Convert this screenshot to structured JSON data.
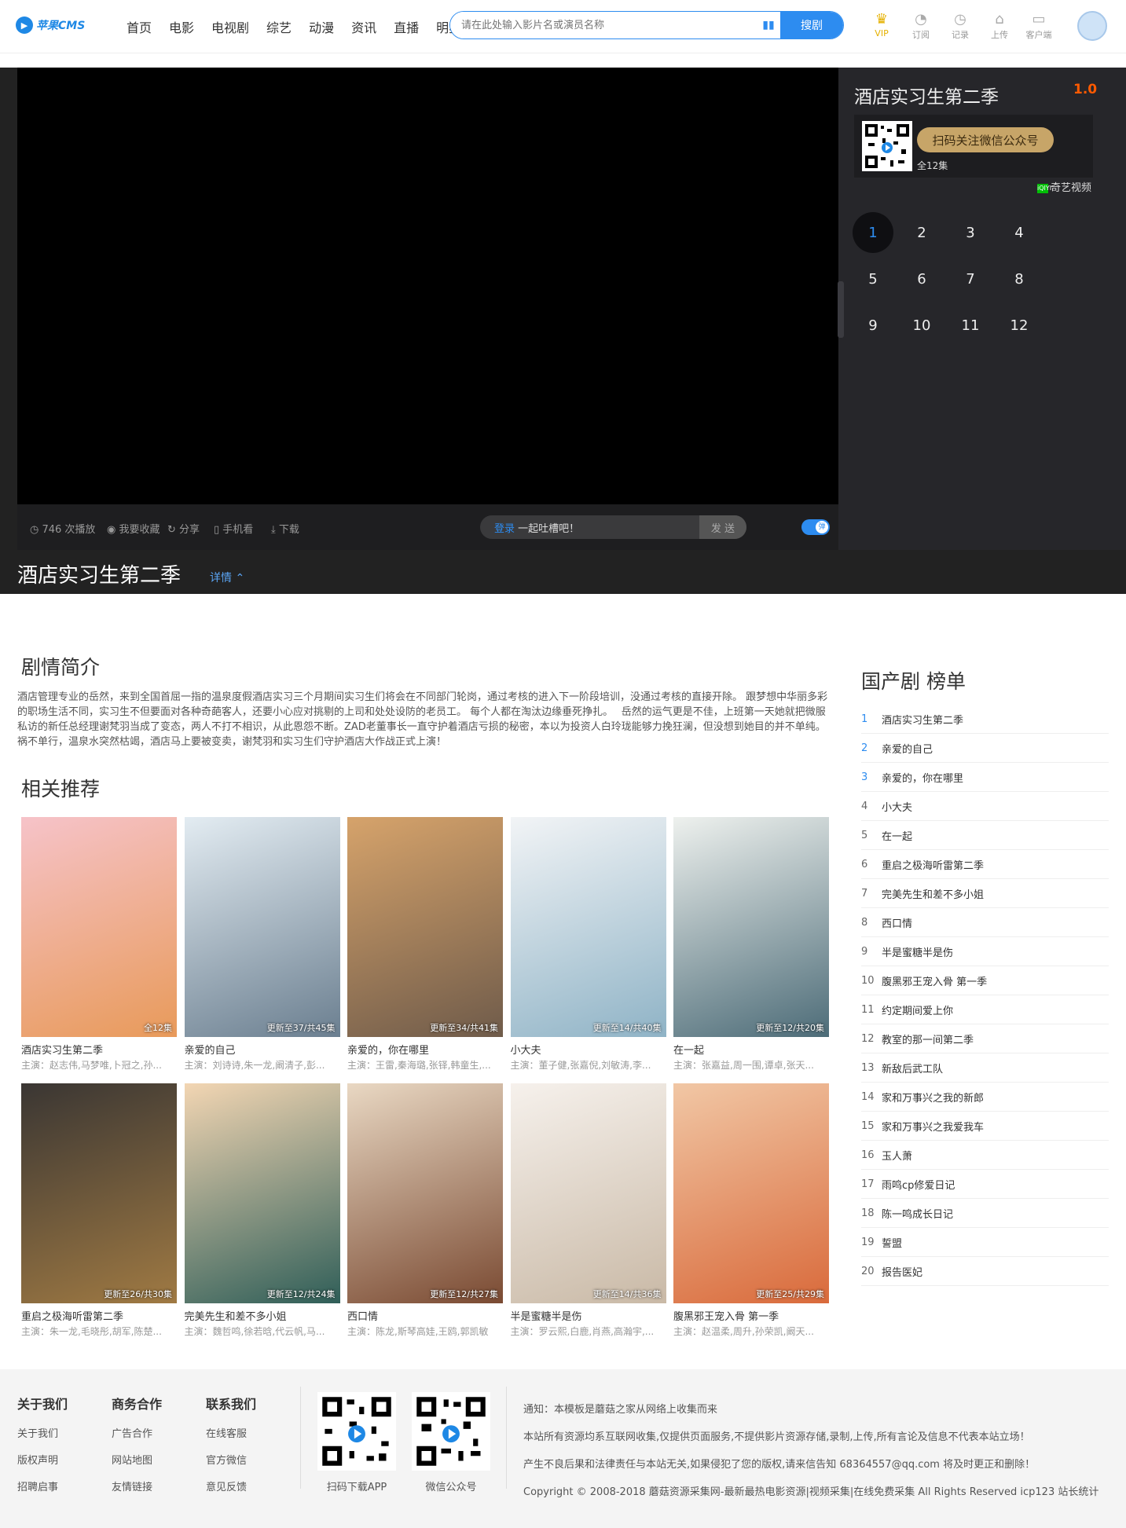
{
  "header": {
    "logo": "苹果CMS",
    "nav": [
      "首页",
      "电影",
      "电视剧",
      "综艺",
      "动漫",
      "资讯",
      "直播",
      "明星"
    ],
    "search_placeholder": "请在此处输入影片名或演员名称",
    "search_button": "搜剧",
    "icons": [
      {
        "label": "VIP",
        "icon": "crown-icon"
      },
      {
        "label": "订阅",
        "icon": "rss-icon"
      },
      {
        "label": "记录",
        "icon": "clock-icon"
      },
      {
        "label": "上传",
        "icon": "upload-icon"
      },
      {
        "label": "客户端",
        "icon": "monitor-icon"
      }
    ]
  },
  "player": {
    "play_count": "746 次播放",
    "favorite": "我要收藏",
    "share": "分享",
    "mobile": "手机看",
    "download": "下载",
    "danmu_login": "登录",
    "danmu_placeholder": "一起吐槽吧！",
    "danmu_send": "发 送",
    "danmu_toggle": "弹"
  },
  "side": {
    "title": "酒店实习生第二季",
    "score": "1.0",
    "qr_button": "扫码关注微信公众号",
    "episodes_total": "全12集",
    "source_badge": "iQIYI",
    "source": "奇艺视频",
    "episodes": [
      "1",
      "2",
      "3",
      "4",
      "5",
      "6",
      "7",
      "8",
      "9",
      "10",
      "11",
      "12"
    ],
    "active_episode": "1"
  },
  "titlebar": {
    "title": "酒店实习生第二季",
    "detail": "详情"
  },
  "intro": {
    "heading": "剧情简介",
    "text": "酒店管理专业的岳然，来到全国首屈一指的温泉度假酒店实习三个月期间实习生们将会在不同部门轮岗，通过考核的进入下一阶段培训，没通过考核的直接开除。 跟梦想中华丽多彩的职场生活不同，实习生不但要面对各种奇葩客人，还要小心应对挑剔的上司和处处设防的老员工。 每个人都在淘汰边缘垂死挣扎。　 岳然的运气更是不佳，上班第一天她就把微服私访的新任总经理谢梵羽当成了变态，两人不打不相识，从此恩怨不断。ZAD老董事长一直守护着酒店亏损的秘密，本以为投资人白玲珑能够力挽狂澜，但没想到她目的并不单纯。祸不单行，温泉水突然枯竭，酒店马上要被变卖，谢梵羽和实习生们守护酒店大作战正式上演！"
  },
  "related": {
    "heading": "相关推荐",
    "items": [
      {
        "name": "酒店实习生第二季",
        "cast": "主演：赵志伟,马梦唯,卜冠之,孙...",
        "tag": "全12集",
        "c1": "#f6c3c9",
        "c2": "#e89a5a"
      },
      {
        "name": "亲爱的自己",
        "cast": "主演：刘诗诗,朱一龙,阚清子,彭...",
        "tag": "更新至37/共45集",
        "c1": "#e3ecf2",
        "c2": "#6b7f90"
      },
      {
        "name": "亲爱的，你在哪里",
        "cast": "主演：王雷,秦海璐,张铎,韩童生,...",
        "tag": "更新至34/共41集",
        "c1": "#d6a36b",
        "c2": "#6f5b4a"
      },
      {
        "name": "小大夫",
        "cast": "主演：董子健,张嘉倪,刘敏涛,李...",
        "tag": "更新至14/共40集",
        "c1": "#f2f4f6",
        "c2": "#8fb3c6"
      },
      {
        "name": "在一起",
        "cast": "主演：张嘉益,周一围,谭卓,张天...",
        "tag": "更新至12/共20集",
        "c1": "#eef1ee",
        "c2": "#4d6c78"
      },
      {
        "name": "重启之极海听雷第二季",
        "cast": "主演：朱一龙,毛晓彤,胡军,陈楚...",
        "tag": "更新至26/共30集",
        "c1": "#3a3633",
        "c2": "#a07a43"
      },
      {
        "name": "完美先生和差不多小姐",
        "cast": "主演：魏哲鸣,徐若晗,代云帆,马...",
        "tag": "更新至12/共24集",
        "c1": "#f3d6b3",
        "c2": "#2f5e58"
      },
      {
        "name": "西口情",
        "cast": "主演：陈龙,斯琴高娃,王鸥,郭凯敏",
        "tag": "更新至12/共27集",
        "c1": "#e9d8c3",
        "c2": "#7a4a32"
      },
      {
        "name": "半是蜜糖半是伤",
        "cast": "主演：罗云熙,白鹿,肖燕,高瀚宇,...",
        "tag": "更新至14/共36集",
        "c1": "#f6f1ec",
        "c2": "#c9b9a6"
      },
      {
        "name": "腹黑邪王宠入骨 第一季",
        "cast": "主演：赵温柔,周升,孙荣凯,阚天...",
        "tag": "更新至25/共29集",
        "c1": "#f1c7a5",
        "c2": "#d96a3b"
      }
    ]
  },
  "rank": {
    "heading": "国产剧 榜单",
    "items": [
      "酒店实习生第二季",
      "亲爱的自己",
      "亲爱的，你在哪里",
      "小大夫",
      "在一起",
      "重启之极海听雷第二季",
      "完美先生和差不多小姐",
      "西口情",
      "半是蜜糖半是伤",
      "腹黑邪王宠入骨 第一季",
      "约定期间爱上你",
      "教室的那一间第二季",
      "新敌后武工队",
      "家和万事兴之我的新郎",
      "家和万事兴之我爱我车",
      "玉人萧",
      "雨鸣cp修爱日记",
      "陈一鸣成长日记",
      "誓盟",
      "报告医妃"
    ]
  },
  "footer": {
    "cols": [
      {
        "title": "关于我们",
        "links": [
          "关于我们",
          "版权声明",
          "招聘启事"
        ]
      },
      {
        "title": "商务合作",
        "links": [
          "广告合作",
          "网站地图",
          "友情链接"
        ]
      },
      {
        "title": "联系我们",
        "links": [
          "在线客服",
          "官方微信",
          "意见反馈"
        ]
      }
    ],
    "qr": [
      "扫码下载APP",
      "微信公众号"
    ],
    "notice": "通知：本模板是蘑菇之家从网络上收集而来",
    "line1": "本站所有资源均系互联网收集,仅提供页面服务,不提供影片资源存储,录制,上传,所有言论及信息不代表本站立场！",
    "line2": "产生不良后果和法律责任与本站无关,如果侵犯了您的版权,请来信告知 68364557@qq.com 将及时更正和删除！",
    "line3": "Copyright © 2008-2018 蘑菇资源采集网-最新最热电影资源|视频采集|在线免费采集 All Rights Reserved icp123 站长统计"
  }
}
